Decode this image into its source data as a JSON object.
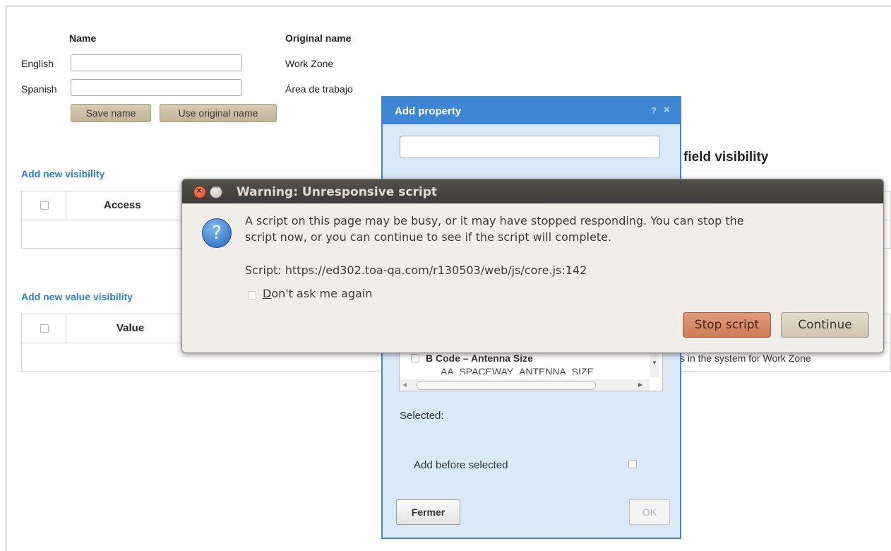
{
  "names": {
    "header_name": "Name",
    "header_original": "Original name",
    "rows": [
      {
        "lang": "English",
        "value": "",
        "original": "Work Zone"
      },
      {
        "lang": "Spanish",
        "value": "",
        "original": "Área de trabajo"
      }
    ],
    "save_button": "Save name",
    "use_original_button": "Use original name"
  },
  "field_visibility_heading": "field visibility",
  "visibility": {
    "add_link": "Add new visibility",
    "column": "Access"
  },
  "value_visibility": {
    "add_link": "Add new value visibility",
    "column": "Value",
    "partial_text": "s in the system for Work Zone"
  },
  "add_property_dialog": {
    "title": "Add property",
    "help_icon": "?",
    "close_icon": "×",
    "search_value": "",
    "list_item": {
      "label": "B Code – Antenna Size",
      "code": "AA_SPACEWAY_ANTENNA_SIZE"
    },
    "selected_label": "Selected:",
    "add_before_label": "Add before selected",
    "close_button": "Fermer",
    "ok_button": "OK"
  },
  "warning_dialog": {
    "title": "Warning: Unresponsive script",
    "message_line1": "A script on this page may be busy, or it may have stopped responding. You can stop the",
    "message_line2": "script now, or you can continue to see if the script will complete.",
    "script_line": "Script: https://ed302.toa-qa.com/r130503/web/js/core.js:142",
    "dont_ask_prefix": "D",
    "dont_ask_rest": "on't ask me again",
    "stop_button": "Stop script",
    "continue_button": "Continue",
    "icon": "?"
  }
}
